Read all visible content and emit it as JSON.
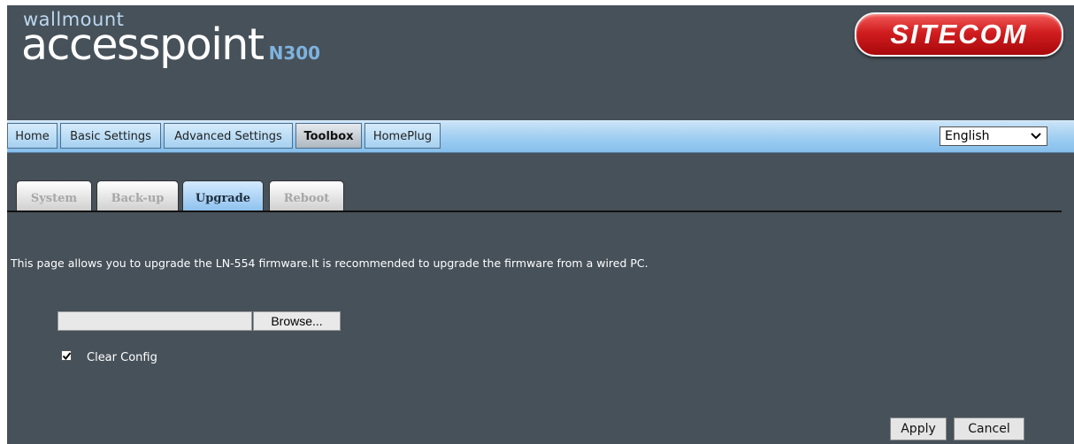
{
  "header": {
    "brand_small": "wallmount",
    "brand_main": "accesspoint",
    "brand_model": "N300",
    "vendor_logo": "SITECOM"
  },
  "nav": {
    "items": [
      {
        "label": "Home"
      },
      {
        "label": "Basic Settings"
      },
      {
        "label": "Advanced Settings"
      },
      {
        "label": "Toolbox",
        "active": true
      },
      {
        "label": "HomePlug"
      }
    ],
    "language": {
      "selected": "English",
      "icon": "chevron-down-icon"
    }
  },
  "tabs": [
    {
      "label": "System"
    },
    {
      "label": "Back-up"
    },
    {
      "label": "Upgrade",
      "active": true
    },
    {
      "label": "Reboot"
    }
  ],
  "content": {
    "description": "This page allows you to upgrade the LN-554 firmware.It is recommended to upgrade the firmware from a wired PC.",
    "file_input_value": "",
    "browse_label": "Browse...",
    "clear_config": {
      "label": "Clear Config",
      "checked": true
    }
  },
  "actions": {
    "apply_label": "Apply",
    "cancel_label": "Cancel"
  },
  "colors": {
    "background": "#47515a",
    "nav_gradient_top": "#cbe4f8",
    "logo_red": "#d11d1f",
    "active_tab": "#8fc2ee"
  }
}
